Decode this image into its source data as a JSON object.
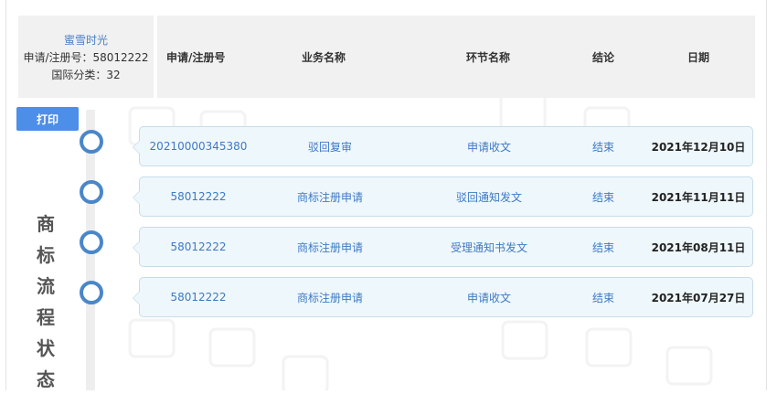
{
  "trademark": {
    "name": "蜜雪时光",
    "reg_line": "申请/注册号：58012222",
    "class_line": "国际分类：32"
  },
  "columns": [
    "申请/注册号",
    "业务名称",
    "环节名称",
    "结论",
    "日期"
  ],
  "print_label": "打印",
  "side_title": "商标流程状态",
  "rows": [
    {
      "number": "20210000345380",
      "business": "驳回复审",
      "step": "申请收文",
      "result": "结束",
      "date": "2021年12月10日"
    },
    {
      "number": "58012222",
      "business": "商标注册申请",
      "step": "驳回通知发文",
      "result": "结束",
      "date": "2021年11月11日"
    },
    {
      "number": "58012222",
      "business": "商标注册申请",
      "step": "受理通知书发文",
      "result": "结束",
      "date": "2021年08月11日"
    },
    {
      "number": "58012222",
      "business": "商标注册申请",
      "step": "申请收文",
      "result": "结束",
      "date": "2021年07月27日"
    }
  ],
  "colors": {
    "accent": "#4d8ee8",
    "node": "#4a87c9",
    "card_bg": "#eef7fb",
    "header_bg": "#f1f1f1"
  }
}
